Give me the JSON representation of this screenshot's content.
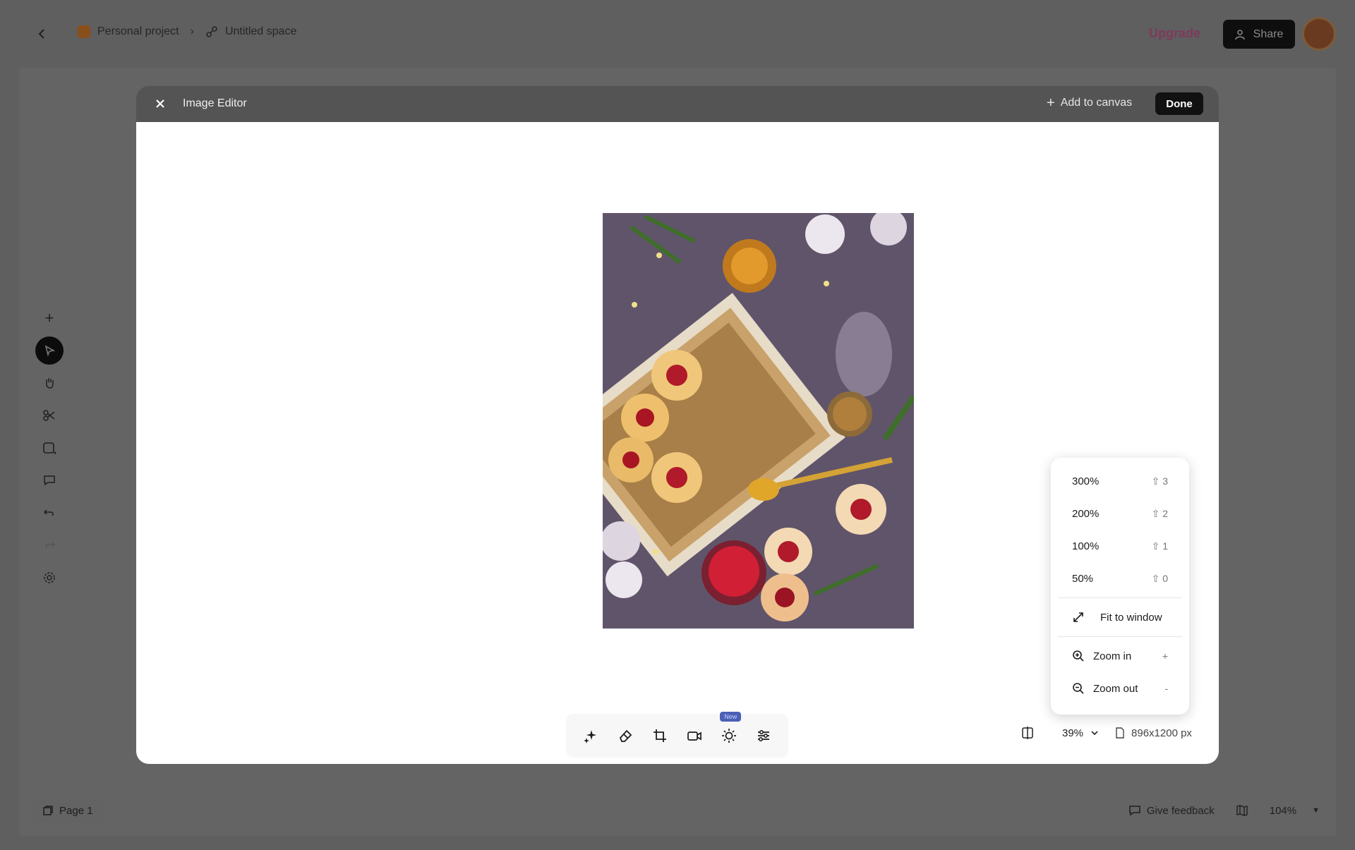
{
  "topbar": {
    "breadcrumb": {
      "project": "Personal project",
      "space": "Untitled space"
    },
    "upgrade_label": "Upgrade",
    "share_label": "Share"
  },
  "left_tools": [
    "add-icon",
    "select-icon",
    "hand-icon",
    "scissors-icon",
    "note-icon",
    "comment-icon",
    "undo-icon",
    "redo-icon",
    "settings-icon"
  ],
  "bottom": {
    "page_label": "Page 1",
    "feedback_label": "Give feedback",
    "canvas_zoom": "104%"
  },
  "editor": {
    "title": "Image Editor",
    "add_to_canvas_label": "Add to canvas",
    "done_label": "Done",
    "toolbar_tools": [
      "magic-sparkle-icon",
      "eraser-icon",
      "crop-icon",
      "camera-icon",
      "light-icon",
      "adjust-sliders-icon"
    ],
    "new_badge": "New",
    "zoom_value": "39%",
    "image_size": "896x1200 px"
  },
  "zoom_menu": {
    "presets": [
      {
        "label": "300%",
        "shortcut": "⇧ 3"
      },
      {
        "label": "200%",
        "shortcut": "⇧ 2"
      },
      {
        "label": "100%",
        "shortcut": "⇧ 1"
      },
      {
        "label": "50%",
        "shortcut": "⇧ 0"
      }
    ],
    "fit_label": "Fit to window",
    "zoom_in_label": "Zoom in",
    "zoom_in_shortcut": "+",
    "zoom_out_label": "Zoom out",
    "zoom_out_shortcut": "-"
  },
  "colors": {
    "upgrade": "#7e3a5a",
    "done_bg": "#111111",
    "new_badge": "#4a5fb5"
  }
}
